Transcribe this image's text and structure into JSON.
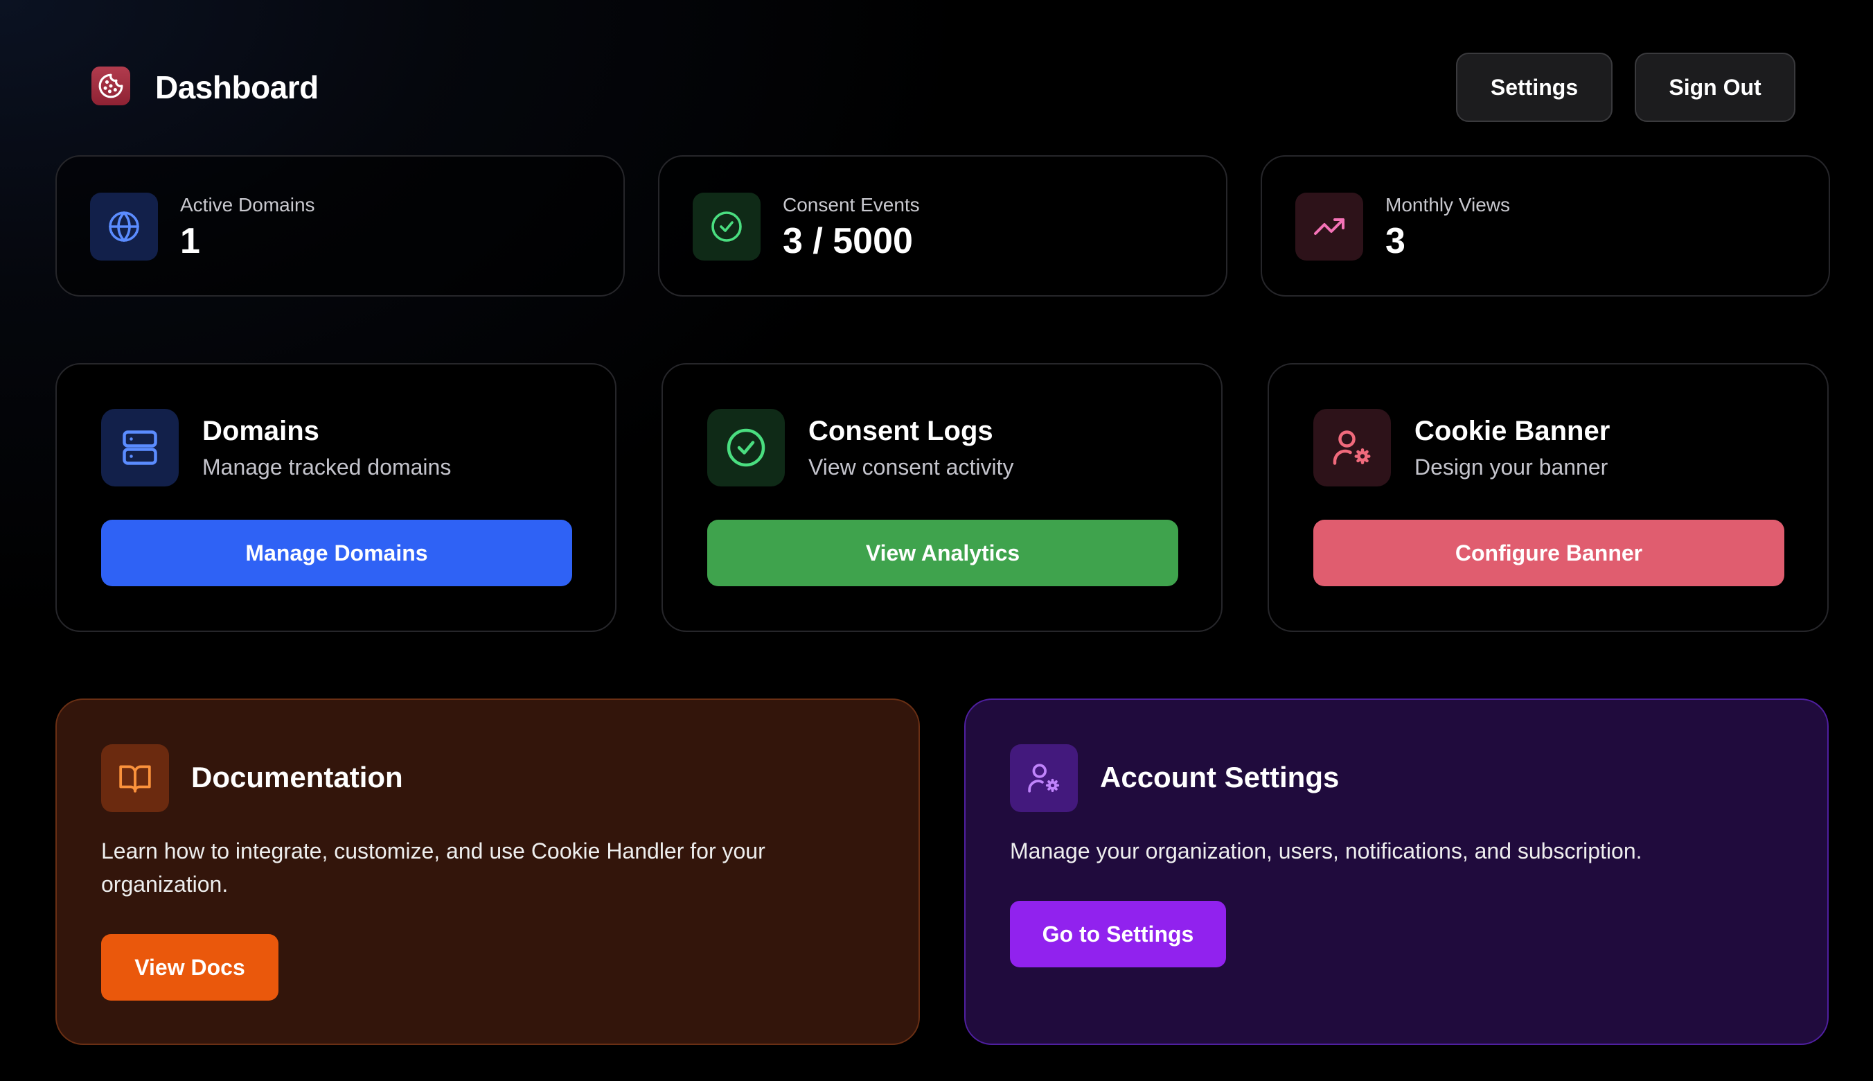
{
  "header": {
    "title": "Dashboard",
    "settings_label": "Settings",
    "signout_label": "Sign Out",
    "logo_icon": "cookie-icon"
  },
  "stats": [
    {
      "label": "Active Domains",
      "value": "1",
      "icon": "globe-icon",
      "color": "#5b8cff"
    },
    {
      "label": "Consent Events",
      "value": "3 / 5000",
      "icon": "check-circle-icon",
      "color": "#4ade80"
    },
    {
      "label": "Monthly Views",
      "value": "3",
      "icon": "trending-up-icon",
      "color": "#f472b6"
    }
  ],
  "features": [
    {
      "title": "Domains",
      "subtitle": "Manage tracked domains",
      "button": "Manage Domains",
      "icon": "server-icon",
      "color": "#2f62f5"
    },
    {
      "title": "Consent Logs",
      "subtitle": "View consent activity",
      "button": "View Analytics",
      "icon": "check-circle-icon",
      "color": "#3fa34d"
    },
    {
      "title": "Cookie Banner",
      "subtitle": "Design your banner",
      "button": "Configure Banner",
      "icon": "user-cog-icon",
      "color": "#e05d6f"
    }
  ],
  "documentation": {
    "title": "Documentation",
    "description": "Learn how to integrate, customize, and use Cookie Handler for your organization.",
    "button": "View Docs",
    "icon": "book-open-icon",
    "color": "#ea580c"
  },
  "account": {
    "title": "Account Settings",
    "description": "Manage your organization, users, notifications, and subscription.",
    "button": "Go to Settings",
    "icon": "user-cog-icon",
    "color": "#9122ee"
  }
}
